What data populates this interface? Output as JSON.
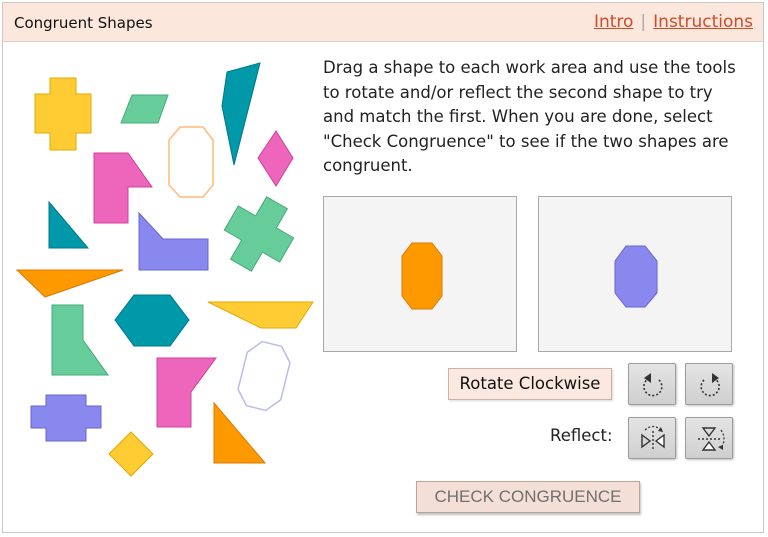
{
  "header": {
    "title": "Congruent Shapes",
    "intro_link": "Intro",
    "separator": "|",
    "instructions_link": "Instructions"
  },
  "instructions_text": "Drag a shape to each work area and use the tools to rotate and/or reflect the second shape to try and match the first. When you are done, select \"Check Congruence\" to see if the two shapes are congruent.",
  "colors": {
    "orange": "#ff9900",
    "yellow": "#ffcc33",
    "green": "#66cc99",
    "teal": "#0099aa",
    "pink": "#ee66bb",
    "purple": "#8888ee",
    "header_bg": "#fbe7dc",
    "link": "#d04a2b"
  },
  "work_areas": [
    {
      "name": "work-area-1",
      "shape": "orange octagon"
    },
    {
      "name": "work-area-2",
      "shape": "purple octagon"
    }
  ],
  "tools": {
    "rotate_label": "Rotate Clockwise",
    "rotate_ccw_icon": "rotate-counterclockwise-icon",
    "rotate_cw_icon": "rotate-clockwise-icon",
    "reflect_label": "Reflect:",
    "reflect_horizontal_icon": "reflect-horizontal-icon",
    "reflect_vertical_icon": "reflect-vertical-icon"
  },
  "check_button": "CHECK CONGRUENCE"
}
